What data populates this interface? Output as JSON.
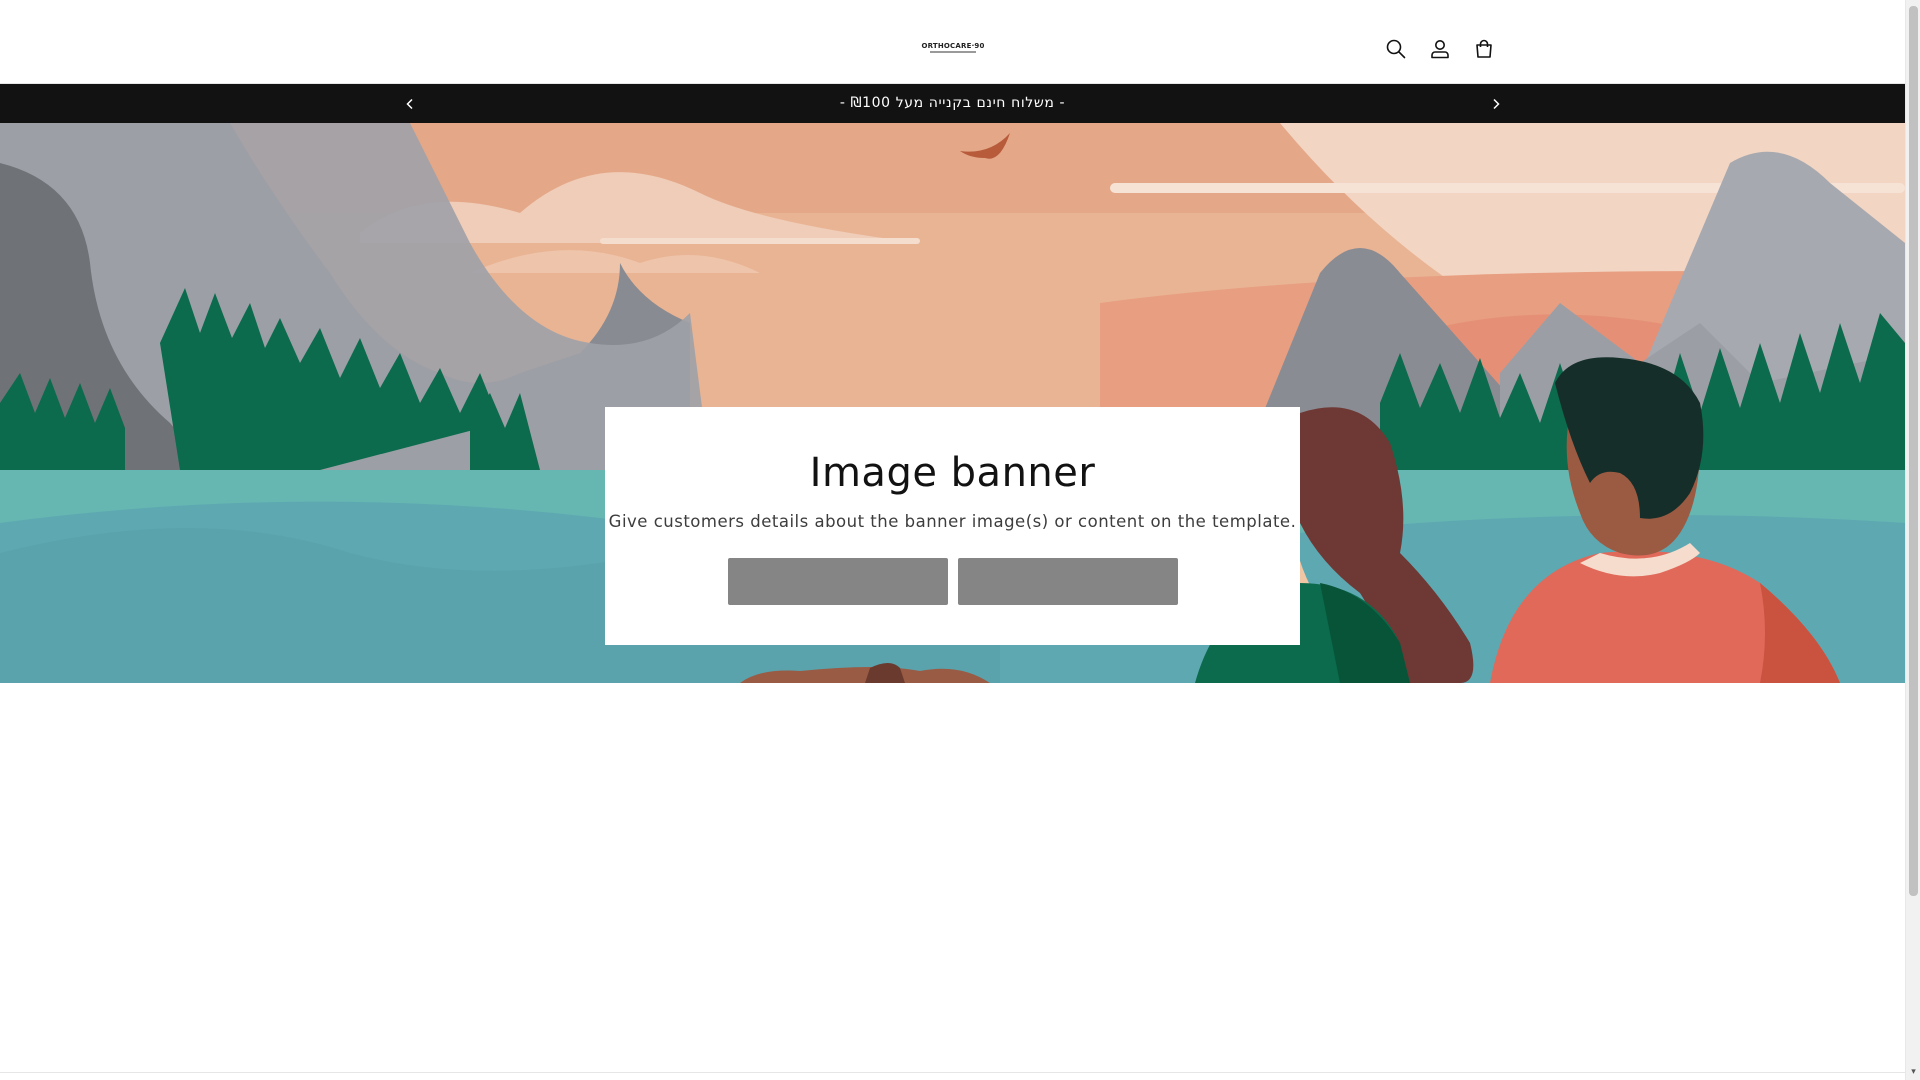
{
  "header": {
    "logo_text": "ORTHOCARE·90",
    "icons": [
      "search-icon",
      "account-icon",
      "cart-icon"
    ]
  },
  "announcement": {
    "text": "- משלוח חינם בקנייה מעל ₪100 -"
  },
  "banner": {
    "title": "Image banner",
    "text": "Give customers details about the banner image(s) or content on the template.",
    "button_1_label": "",
    "button_2_label": ""
  },
  "colors": {
    "announcement_bg": "#121212",
    "button_bg": "#858585"
  }
}
